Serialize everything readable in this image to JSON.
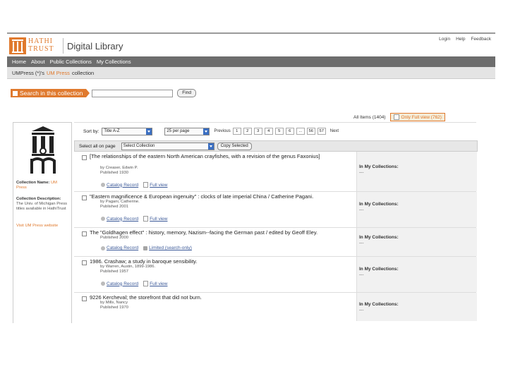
{
  "header": {
    "logo_top": "HATHI",
    "logo_bottom": "TRUST",
    "library_name": "Digital Library",
    "top_links": [
      "Login",
      "Help",
      "Feedback"
    ]
  },
  "nav": {
    "items": [
      "Home",
      "About",
      "Public Collections",
      "My Collections"
    ]
  },
  "collection_bar": {
    "prefix": "UMPress (*)'s",
    "name": "UM Press",
    "suffix": "collection"
  },
  "search": {
    "label": "Search in this collection",
    "find_label": "Find"
  },
  "item_tabs": {
    "all": "All Items (1404)",
    "full": "Only Full view (762)"
  },
  "sidebar": {
    "name_label": "Collection Name:",
    "name_value": "UM Press",
    "desc_label": "Collection Description:",
    "desc_value": "The Univ. of Michigan Press titles available in HathiTrust",
    "visit": "Visit UM Press website"
  },
  "sort": {
    "label": "Sort by:",
    "sort_value": "Title A-Z",
    "per_page": "25 per page",
    "previous": "Previous",
    "pages": [
      "1",
      "2",
      "3",
      "4",
      "5",
      "6",
      "...",
      "56",
      "57"
    ],
    "next": "Next"
  },
  "select_bar": {
    "select_all": "Select all on page",
    "select_collection": "Select Collection",
    "copy_selected": "Copy Selected"
  },
  "records": [
    {
      "title": "[The relationships of the eastern North American crayfishes, with a revision of the genus Faxonius]",
      "author": "by Creaser, Edwin P.",
      "published": "Published 1930",
      "link1": "Catalog Record",
      "link2": "Full view",
      "coll_label": "In My Collections:",
      "coll_value": "---"
    },
    {
      "title": "\"Eastern magnificence & European ingenuity\" : clocks of late imperial China / Catherine Pagani.",
      "author": "by Pagani, Catherine.",
      "published": "Published 2001",
      "link1": "Catalog Record",
      "link2": "Full view",
      "coll_label": "In My Collections:",
      "coll_value": "---"
    },
    {
      "title": "The \"Goldhagen effect\" : history, memory, Nazism--facing the German past / edited by Geoff Eley.",
      "author": "",
      "published": "Published 2000",
      "link1": "Catalog Record",
      "link2": "Limited (search-only)",
      "coll_label": "In My Collections:",
      "coll_value": "---"
    },
    {
      "title": "1986. Crashaw; a study in baroque sensibility.",
      "author": "by Warren, Austin, 1899-1986.",
      "published": "Published 1957",
      "link1": "Catalog Record",
      "link2": "Full view",
      "coll_label": "In My Collections:",
      "coll_value": "---"
    },
    {
      "title": "9226 Kercheval; the storefront that did not burn.",
      "author": "by Mills, Nancy",
      "published": "Published 1970",
      "link1": "",
      "link2": "",
      "coll_label": "In My Collections:",
      "coll_value": "---"
    }
  ]
}
